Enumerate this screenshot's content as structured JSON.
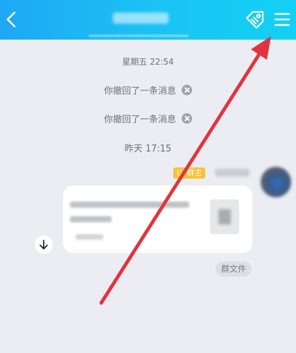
{
  "header": {
    "back_icon": "chevron-left-icon",
    "ticket_icon": "ticket-tag-icon",
    "menu_icon": "hamburger-menu-icon",
    "accent_color": "#1BB8F4"
  },
  "messages": {
    "timestamp_1": "星期五 22:54",
    "recall_1": "你撤回了一条消息",
    "recall_2": "你撤回了一条消息",
    "timestamp_2": "昨天 17:15"
  },
  "sender": {
    "level": "LV",
    "role_badge": "群主"
  },
  "file_message": {
    "tag": "群文件",
    "download_icon": "download-arrow-icon"
  },
  "annotation": {
    "arrow_color": "#E2343E"
  }
}
